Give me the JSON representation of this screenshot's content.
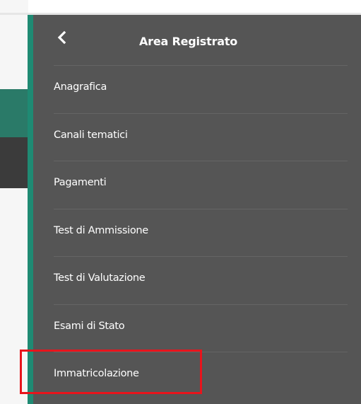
{
  "panel": {
    "title": "Area Registrato",
    "back_icon": "chevron-left-icon",
    "accent_color": "#1f8a73",
    "background_color": "#555555"
  },
  "menu": {
    "items": [
      {
        "label": "Anagrafica"
      },
      {
        "label": "Canali tematici"
      },
      {
        "label": "Pagamenti"
      },
      {
        "label": "Test di Ammissione"
      },
      {
        "label": "Test di Valutazione"
      },
      {
        "label": "Esami di Stato"
      },
      {
        "label": "Immatricolazione",
        "highlighted": true
      }
    ]
  },
  "highlight": {
    "color": "#e8141c"
  }
}
